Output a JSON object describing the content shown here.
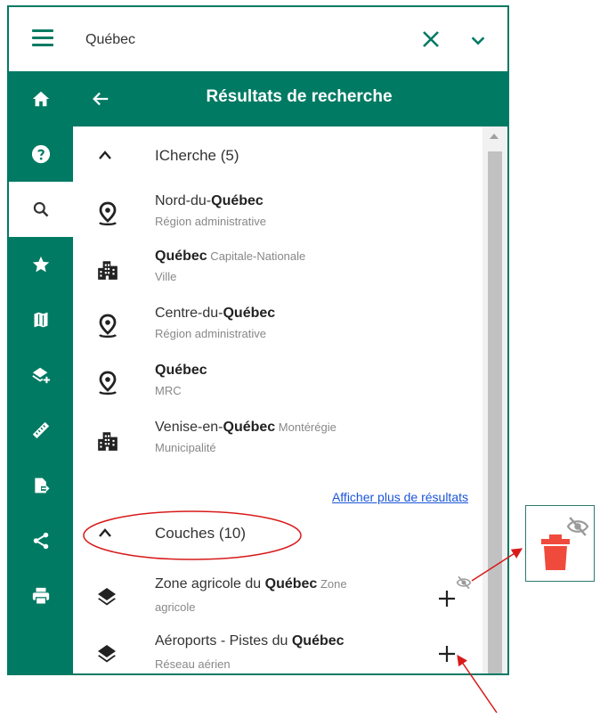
{
  "search": {
    "value": "Québec"
  },
  "panel": {
    "title": "Résultats de recherche"
  },
  "sections": [
    {
      "title": "ICherche (5)"
    },
    {
      "title": "Couches (10)"
    }
  ],
  "results": [
    {
      "prefix": "Nord-du-",
      "bold": "Québec",
      "suffix": "",
      "context": "",
      "subtitle": "Région administrative",
      "icon": "map-marker-icon"
    },
    {
      "prefix": "",
      "bold": "Québec",
      "suffix": "",
      "context": " Capitale-Nationale",
      "subtitle": "Ville",
      "icon": "city-icon"
    },
    {
      "prefix": "Centre-du-",
      "bold": "Québec",
      "suffix": "",
      "context": "",
      "subtitle": "Région administrative",
      "icon": "map-marker-icon"
    },
    {
      "prefix": "",
      "bold": "Québec",
      "suffix": "",
      "context": "",
      "subtitle": "MRC",
      "icon": "map-marker-icon"
    },
    {
      "prefix": "Venise-en-",
      "bold": "Québec",
      "suffix": "",
      "context": " Montérégie",
      "subtitle": "Municipalité",
      "icon": "city-icon"
    }
  ],
  "more_results": "Afficher plus de résultats",
  "layers": [
    {
      "prefix": "Zone agricole du ",
      "bold": "Québec",
      "context": " Zone",
      "subtitle": "agricole",
      "icon": "layers-icon"
    },
    {
      "prefix": "Aéroports - Pistes du ",
      "bold": "Québec",
      "context": "",
      "subtitle": "Réseau aérien",
      "icon": "layers-icon"
    }
  ],
  "sidebar": [
    "home-icon",
    "help-icon",
    "search-icon",
    "star-icon",
    "map-icon",
    "layer-add-icon",
    "ruler-icon",
    "file-export-icon",
    "share-icon",
    "print-icon"
  ],
  "colors": {
    "brand": "#007a63",
    "link": "#1a55d9",
    "annotation": "#d81a1a",
    "trash": "#f04a3d"
  }
}
